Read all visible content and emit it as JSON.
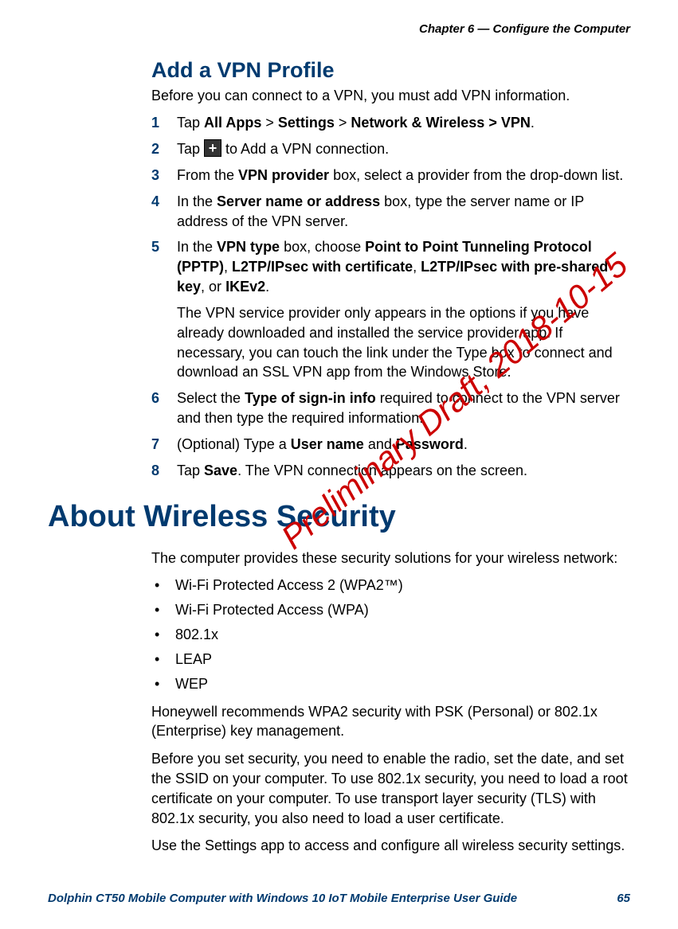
{
  "running_head": "Chapter 6 — Configure the Computer",
  "section1": {
    "title": "Add a VPN Profile",
    "intro": "Before you can connect to a VPN, you must add VPN information.",
    "steps": {
      "s1": {
        "pre": "Tap ",
        "b1": "All Apps",
        "gt1": " > ",
        "b2": "Settings",
        "gt2": " > ",
        "b3": "Network & Wireless > VPN",
        "post": "."
      },
      "s2": {
        "pre": "Tap ",
        "post": " to Add a VPN connection."
      },
      "s3": {
        "pre": "From the ",
        "b1": "VPN provider",
        "post": " box, select a provider from the drop-down list."
      },
      "s4": {
        "pre": "In the ",
        "b1": "Server name or address",
        "post": " box, type the server name or IP address of the VPN server."
      },
      "s5": {
        "pre": "In the ",
        "b1": "VPN type",
        "mid1": " box, choose ",
        "b2": "Point to Point Tunneling Protocol (PPTP)",
        "sep1": ", ",
        "b3": "L2TP/IPsec with certificate",
        "sep2": ", ",
        "b4": "L2TP/IPsec with pre-shared key",
        "sep3": ", or ",
        "b5": "IKEv2",
        "post": ".",
        "sub": "The VPN service provider only appears in the options if you have already downloaded and installed the service provider app. If necessary, you can touch the link under the Type box to connect and download an SSL VPN app from the Windows Store."
      },
      "s6": {
        "pre": "Select the ",
        "b1": "Type of sign-in info",
        "post": " required to connect to the VPN server and then type the required information."
      },
      "s7": {
        "pre": "(Optional) Type a ",
        "b1": "User name",
        "mid": " and ",
        "b2": "Password",
        "post": "."
      },
      "s8": {
        "pre": "Tap ",
        "b1": "Save",
        "post": ". The VPN connection appears on the screen."
      }
    }
  },
  "section2": {
    "title": "About Wireless Security",
    "intro": "The computer provides these security solutions for your wireless network:",
    "bullets": [
      "Wi-Fi Protected Access 2 (WPA2™)",
      "Wi-Fi Protected Access (WPA)",
      "802.1x",
      "LEAP",
      "WEP"
    ],
    "para1": "Honeywell recommends WPA2 security with PSK (Personal) or 802.1x (Enterprise) key management.",
    "para2": "Before you set security, you need to enable the radio, set the date, and set the SSID on your computer. To use 802.1x security, you need to load a root certificate on your computer. To use transport layer security (TLS) with 802.1x security, you also need to load a user certificate.",
    "para3": "Use the Settings app to access and configure all wireless security settings."
  },
  "footer": {
    "left": "Dolphin CT50 Mobile Computer with Windows 10 IoT Mobile Enterprise User Guide",
    "right": "65"
  },
  "watermark": "Preliminary Draft, 2018-10-15",
  "plus_glyph": "+"
}
